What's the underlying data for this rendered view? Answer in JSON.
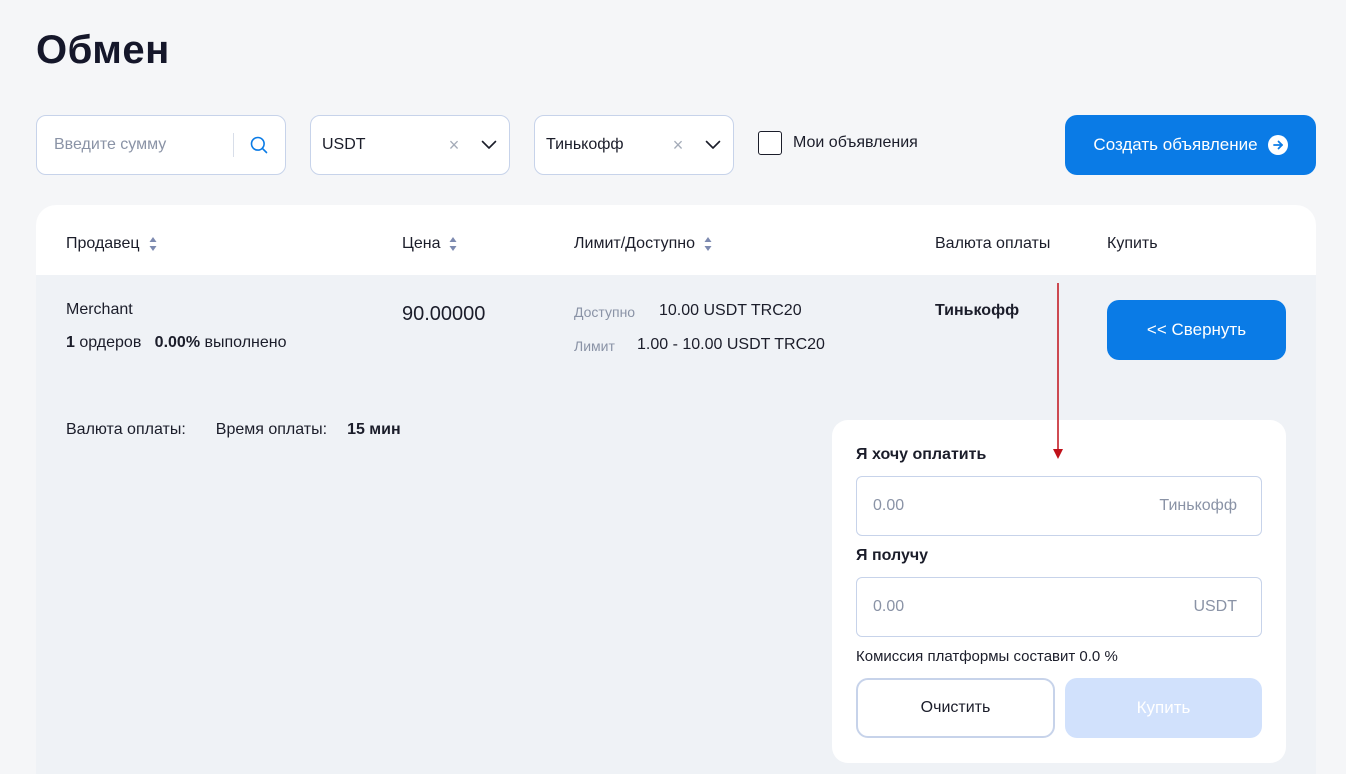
{
  "page": {
    "title": "Обмен"
  },
  "filters": {
    "search_placeholder": "Введите сумму",
    "currency": {
      "value": "USDT",
      "clear": "×"
    },
    "bank": {
      "value": "Тинькофф",
      "clear": "×"
    },
    "my_ads_label": "Мои объявления",
    "my_ads_checked": false,
    "create_button_label": "Создать объявление"
  },
  "table": {
    "headers": {
      "seller": "Продавец",
      "price": "Цена",
      "limit": "Лимит/Доступно",
      "currency": "Валюта оплаты",
      "buy": "Купить"
    },
    "row": {
      "seller_name": "Merchant",
      "orders_count": "1",
      "orders_label": "ордеров",
      "completion": "0.00%",
      "completion_label": "выполнено",
      "price": "90.00000",
      "available_label": "Доступно",
      "available_value": "10.00 USDT TRC20",
      "limit_label": "Лимит",
      "limit_value": "1.00 - 10.00 USDT TRC20",
      "currency": "Тинькофф",
      "collapse_button_label": "<< Свернуть"
    },
    "details": {
      "currency_label": "Валюта оплаты:",
      "time_label": "Время оплаты:",
      "time_value": "15 мин"
    }
  },
  "purchase_form": {
    "pay_label": "Я хочу оплатить",
    "pay_placeholder": "0.00",
    "pay_unit": "Тинькофф",
    "receive_label": "Я получу",
    "receive_placeholder": "0.00",
    "receive_unit": "USDT",
    "fee_note": "Комиссия платформы составит 0.0 %",
    "clear_button_label": "Очистить",
    "buy_button_label": "Купить"
  },
  "colors": {
    "primary": "#0a7be6",
    "disabled_button": "#d1e1fc",
    "annotation_arrow": "#c0111a"
  }
}
